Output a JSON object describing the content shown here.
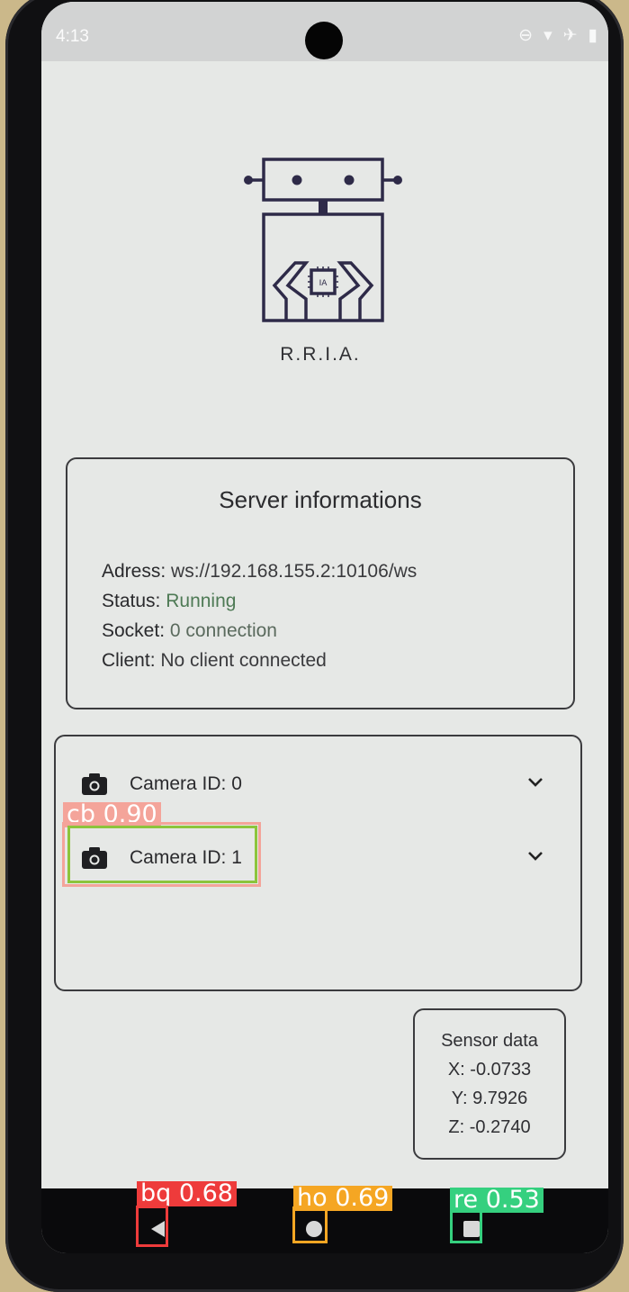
{
  "status_bar": {
    "time": "4:13",
    "icons": [
      "do-not-disturb-icon",
      "wifi-icon",
      "airplane-icon",
      "battery-icon"
    ]
  },
  "app": {
    "name": "R.R.I.A.",
    "logo_chip_text": "IA"
  },
  "server": {
    "title": "Server informations",
    "address_label": "Adress:",
    "address_value": "ws://192.168.155.2:10106/ws",
    "status_label": "Status:",
    "status_value": "Running",
    "socket_label": "Socket:",
    "socket_value": "0 connection",
    "client_label": "Client:",
    "client_value": "No client connected"
  },
  "cameras": [
    {
      "label": "Camera ID: 0"
    },
    {
      "label": "Camera ID: 1"
    }
  ],
  "sensor": {
    "title": "Sensor data",
    "x": "X: -0.0733",
    "y": "Y: 9.7926",
    "z": "Z: -0.2740"
  },
  "detections": {
    "cb": "cb  0.90",
    "bq": "bq  0.68",
    "ho": "ho  0.69",
    "re": "re  0.53"
  },
  "colors": {
    "cb": "#f4a49a",
    "cb_inner": "#8cc43c",
    "bq": "#ee3b3b",
    "ho": "#f5a623",
    "re": "#35d07f"
  }
}
